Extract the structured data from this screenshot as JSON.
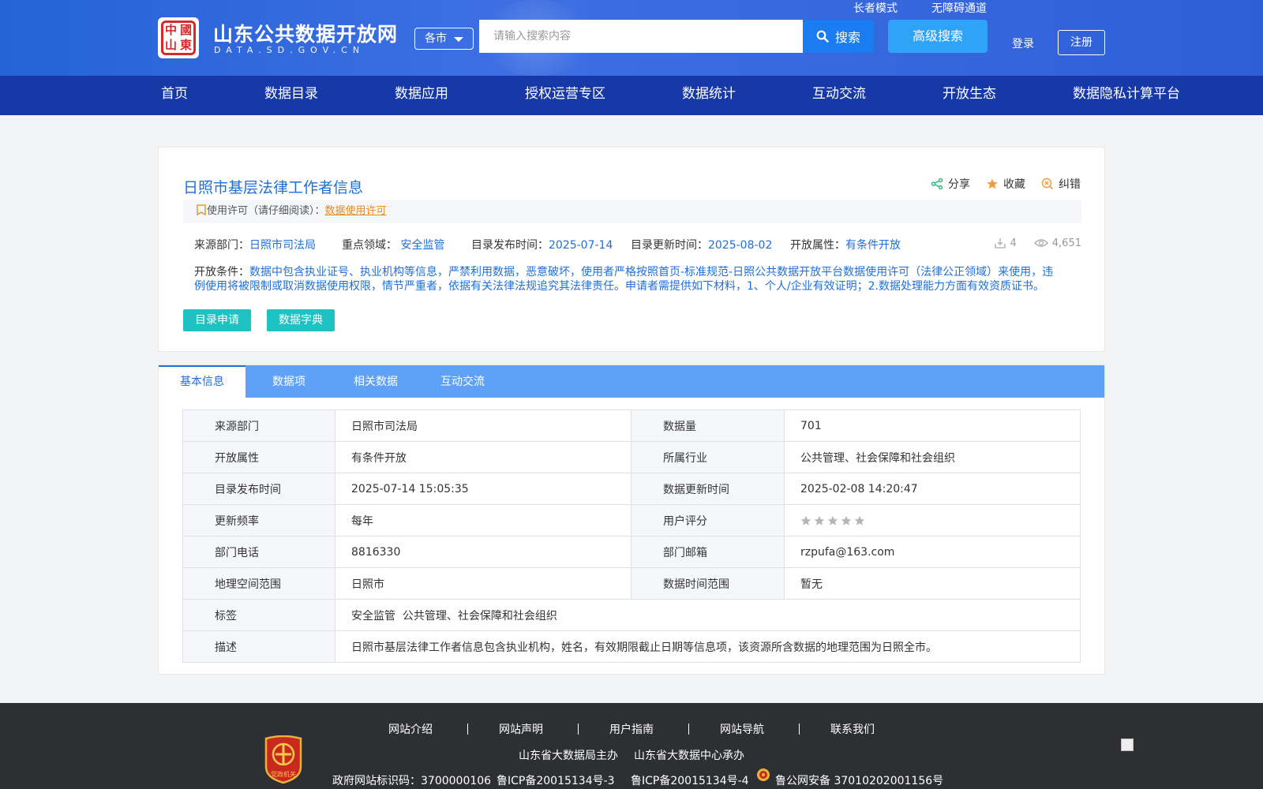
{
  "header": {
    "logo_seal_chars": [
      "中",
      "國",
      "山",
      "東"
    ],
    "logo_title": "山东公共数据开放网",
    "logo_subtitle": "DATA.SD.GOV.CN",
    "city_select": "各市",
    "search_placeholder": "请输入搜索内容",
    "search_button": "搜索",
    "advanced_search": "高级搜索",
    "elder_mode": "长者模式",
    "accessibility": "无障碍通道",
    "login": "登录",
    "register": "注册"
  },
  "nav": [
    "首页",
    "数据目录",
    "数据应用",
    "授权运营专区",
    "数据统计",
    "互动交流",
    "开放生态",
    "数据隐私计算平台"
  ],
  "dataset": {
    "title": "日照市基层法律工作者信息",
    "actions": {
      "share": "分享",
      "favorite": "收藏",
      "report": "纠错"
    },
    "license_label": "使用许可（请仔细阅读）：",
    "license_link": "数据使用许可",
    "meta": {
      "source_label": "来源部门：",
      "source": "日照市司法局",
      "domain_label": "重点领域：",
      "domain": "安全监管",
      "publish_label": "目录发布时间：",
      "publish": "2025-07-14",
      "update_label": "目录更新时间：",
      "update": "2025-08-02",
      "open_label": "开放属性：",
      "open": "有条件开放",
      "downloads": "4",
      "views": "4,651"
    },
    "condition_label": "开放条件：",
    "condition": "数据中包含执业证号、执业机构等信息，严禁利用数据，恶意破坏，使用者严格按照首页-标准规范-日照公共数据开放平台数据使用许可（法律公正领域）来使用，违例使用将被限制或取消数据使用权限，情节严重者，依据有关法律法规追究其法律责任。申请者需提供如下材料，1、个人/企业有效证明；2.数据处理能力方面有效资质证书。",
    "btn_apply": "目录申请",
    "btn_dict": "数据字典"
  },
  "tabs": [
    "基本信息",
    "数据项",
    "相关数据",
    "互动交流"
  ],
  "info": {
    "rows": [
      [
        "来源部门",
        "日照市司法局",
        "数据量",
        "701"
      ],
      [
        "开放属性",
        "有条件开放",
        "所属行业",
        "公共管理、社会保障和社会组织"
      ],
      [
        "目录发布时间",
        "2025-07-14 15:05:35",
        "数据更新时间",
        "2025-02-08 14:20:47"
      ],
      [
        "更新频率",
        "每年",
        "用户评分",
        ""
      ],
      [
        "部门电话",
        "8816330",
        "部门邮箱",
        "rzpufa@163.com"
      ],
      [
        "地理空间范围",
        "日照市",
        "数据时间范围",
        "暂无"
      ]
    ],
    "tags_label": "标签",
    "tags": "安全监管  公共管理、社会保障和社会组织",
    "desc_label": "描述",
    "desc": "日照市基层法律工作者信息包含执业机构，姓名，有效期限截止日期等信息项，该资源所含数据的地理范围为日照全市。",
    "rating_stars": 0,
    "rating_max": 5
  },
  "footer": {
    "links": [
      "网站介绍",
      "网站声明",
      "用户指南",
      "网站导航",
      "联系我们"
    ],
    "host": "山东省大数据局主办",
    "operator": "山东省大数据中心承办",
    "gov_id": "政府网站标识码：3700000106",
    "icp1": "鲁ICP备20015134号-3",
    "icp2": "鲁ICP备20015134号-4",
    "police": "鲁公网安备 37010202001156号",
    "party_badge_text": "党政机关"
  },
  "colors": {
    "header_blue": "#2f64dc",
    "nav_blue": "#1739a8",
    "link_blue": "#1e6fd9",
    "teal": "#1fc2c2",
    "orange": "#e88a17",
    "tab_blue": "#5fa1f6"
  }
}
